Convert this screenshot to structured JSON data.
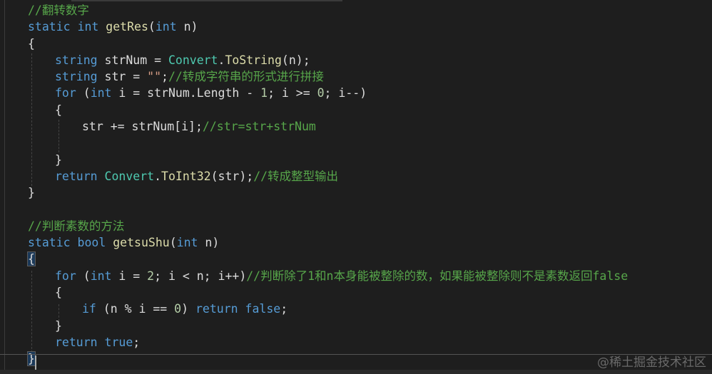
{
  "watermark": "@稀土掘金技术社区",
  "code": {
    "l1_comment": "//翻转数字",
    "l2_static": "static",
    "l2_int": "int",
    "l2_name": "getRes",
    "l2_open": "(",
    "l2_ptype": "int",
    "l2_param": " n)",
    "l3_brace": "{",
    "l4_type": "string",
    "l4_rest": " strNum = ",
    "l4_cls": "Convert",
    "l4_dot": ".",
    "l4_fn": "ToString",
    "l4_end": "(n);",
    "l5_type": "string",
    "l5_rest": " str = ",
    "l5_str": "\"\"",
    "l5_semi": ";",
    "l5_cmt": "//转成字符串的形式进行拼接",
    "l6_for": "for",
    "l6_open": " (",
    "l6_int": "int",
    "l6_a": " i = strNum.Length - ",
    "l6_n1": "1",
    "l6_b": "; i >= ",
    "l6_n0": "0",
    "l6_c": "; i--)",
    "l7_brace": "{",
    "l8_code": "str += strNum[i];",
    "l8_cmt": "//str=str+strNum",
    "l9_blank": "",
    "l10_brace": "}",
    "l11_ret": "return",
    "l11_sp": " ",
    "l11_cls": "Convert",
    "l11_dot": ".",
    "l11_fn": "ToInt32",
    "l11_end": "(str);",
    "l11_cmt": "//转成整型输出",
    "l12_brace": "}",
    "l13_blank": "",
    "l14_comment": "//判断素数的方法",
    "l15_static": "static",
    "l15_bool": "bool",
    "l15_name": "getsuShu",
    "l15_open": "(",
    "l15_ptype": "int",
    "l15_param": " n)",
    "l16_brace": "{",
    "l17_for": "for",
    "l17_open": " (",
    "l17_int": "int",
    "l17_a": " i = ",
    "l17_n2": "2",
    "l17_b": "; i < n; i++)",
    "l17_cmt": "//判断除了1和n本身能被整除的数，如果能被整除则不是素数返回false",
    "l18_brace": "{",
    "l19_if": "if",
    "l19_a": " (n % i == ",
    "l19_n0": "0",
    "l19_b": ") ",
    "l19_ret": "return",
    "l19_sp": " ",
    "l19_false": "false",
    "l19_semi": ";",
    "l20_brace": "}",
    "l21_ret": "return",
    "l21_sp": " ",
    "l21_true": "true",
    "l21_semi": ";",
    "l22_brace": "}"
  }
}
